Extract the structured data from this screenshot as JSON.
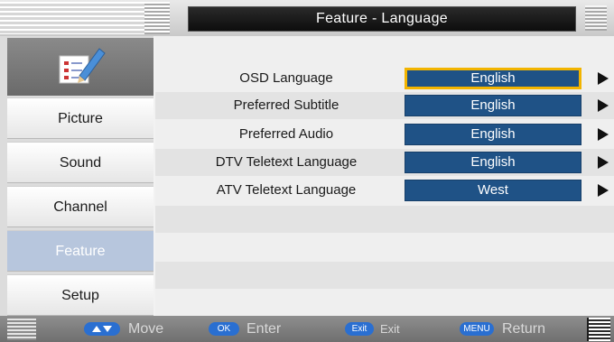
{
  "header": {
    "title": "Feature - Language"
  },
  "sidebar": {
    "items": [
      {
        "label": "Picture",
        "active": false
      },
      {
        "label": "Sound",
        "active": false
      },
      {
        "label": "Channel",
        "active": false
      },
      {
        "label": "Feature",
        "active": true
      },
      {
        "label": "Setup",
        "active": false
      }
    ]
  },
  "settings": [
    {
      "label": "OSD Language",
      "value": "English",
      "focused": true
    },
    {
      "label": "Preferred Subtitle",
      "value": "English",
      "focused": false
    },
    {
      "label": "Preferred Audio",
      "value": "English",
      "focused": false
    },
    {
      "label": "DTV Teletext Language",
      "value": "English",
      "focused": false
    },
    {
      "label": "ATV Teletext Language",
      "value": "West",
      "focused": false
    }
  ],
  "footer": {
    "move_label": "Move",
    "ok_key": "OK",
    "enter_label": "Enter",
    "exit_key": "Exit",
    "exit_label": "Exit",
    "menu_key": "MENU",
    "return_label": "Return"
  },
  "colors": {
    "value_box": "#1f5286",
    "focus_border": "#f2b400",
    "active_sidebar": "#b7c6dd",
    "key_pill": "#2a6fd1"
  }
}
